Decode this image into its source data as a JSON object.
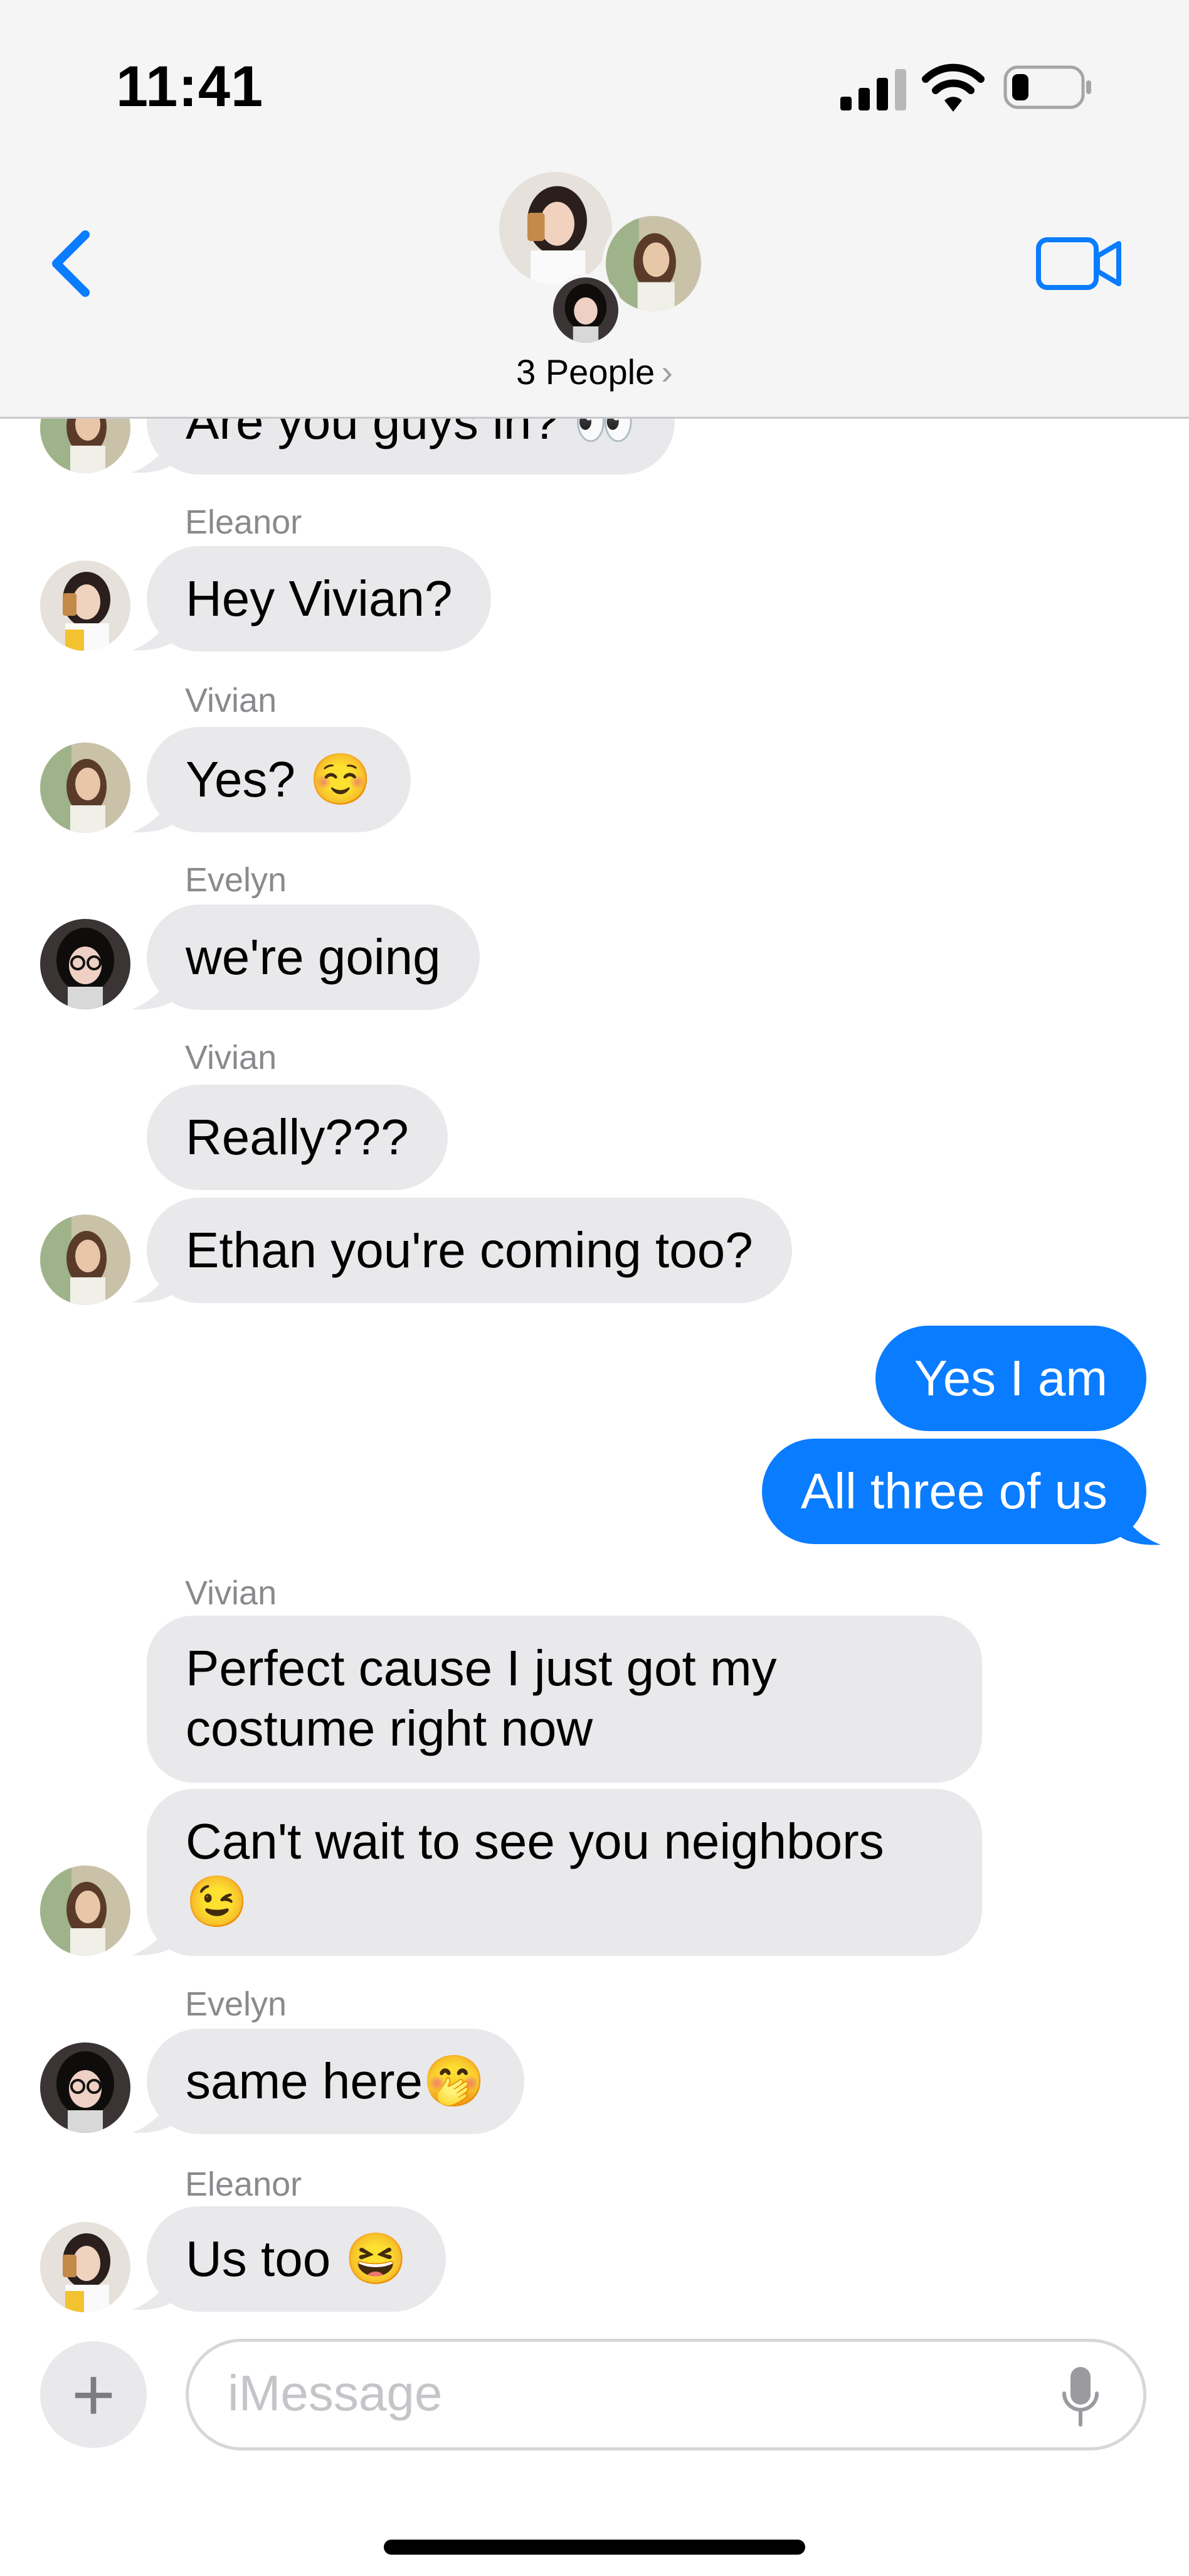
{
  "status_bar": {
    "time": "11:41"
  },
  "header": {
    "people_label": "3 People",
    "chevron": "›"
  },
  "messages": [
    {
      "sender": "",
      "text": "Are you guys in? 👀"
    },
    {
      "sender": "Eleanor",
      "text": "Hey Vivian?"
    },
    {
      "sender": "Vivian",
      "text": "Yes? ☺️"
    },
    {
      "sender": "Evelyn",
      "text": "we're going"
    },
    {
      "sender": "Vivian",
      "text": "Really???"
    },
    {
      "sender": "",
      "text": "Ethan you're coming too?"
    },
    {
      "sender": "",
      "text": "Yes I am"
    },
    {
      "sender": "",
      "text": "All three of us"
    },
    {
      "sender": "Vivian",
      "text": "Perfect cause I just got my costume right now"
    },
    {
      "sender": "",
      "text": "Can't wait to see you neighbors 😉"
    },
    {
      "sender": "Evelyn",
      "text": "same here🤭"
    },
    {
      "sender": "Eleanor",
      "text": "Us too 😆"
    }
  ],
  "composer": {
    "placeholder": "iMessage",
    "plus": "+"
  },
  "colors": {
    "sent_bubble": "#0a7cff",
    "received_bubble": "#e9e9eb",
    "accent": "#0a7cff"
  }
}
